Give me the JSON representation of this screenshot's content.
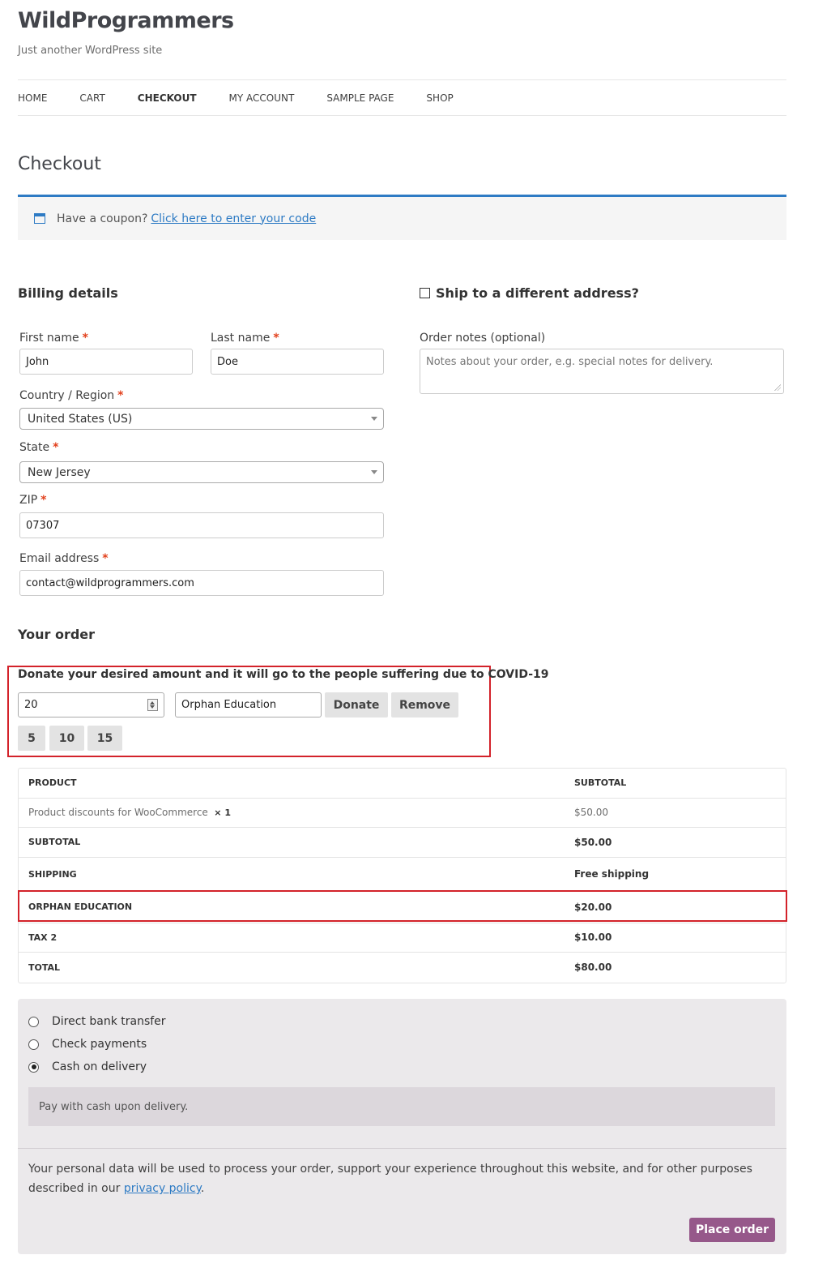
{
  "site": {
    "title": "WildProgrammers",
    "tagline": "Just another WordPress site"
  },
  "nav": {
    "items": [
      "HOME",
      "CART",
      "CHECKOUT",
      "MY ACCOUNT",
      "SAMPLE PAGE",
      "SHOP"
    ],
    "active": "CHECKOUT"
  },
  "page": {
    "title": "Checkout"
  },
  "coupon": {
    "icon": "calendar-icon",
    "prompt": "Have a coupon?",
    "link": "Click here to enter your code"
  },
  "billing": {
    "heading": "Billing details",
    "first_name_label": "First name",
    "first_name_value": "John",
    "last_name_label": "Last name",
    "last_name_value": "Doe",
    "country_label": "Country / Region",
    "country_value": "United States (US)",
    "state_label": "State",
    "state_value": "New Jersey",
    "zip_label": "ZIP",
    "zip_value": "07307",
    "email_label": "Email address",
    "email_value": "contact@wildprogrammers.com",
    "required_mark": "*"
  },
  "shipping": {
    "toggle_label": "Ship to a different address?",
    "notes_label": "Order notes (optional)",
    "notes_placeholder": "Notes about your order, e.g. special notes for delivery."
  },
  "order": {
    "heading": "Your order",
    "donate": {
      "title": "Donate your desired amount and it will go to the people suffering due to COVID-19",
      "amount": "20",
      "cause": "Orphan Education",
      "donate_button": "Donate",
      "remove_button": "Remove",
      "presets": [
        "5",
        "10",
        "15"
      ]
    },
    "table": {
      "headers": [
        "PRODUCT",
        "SUBTOTAL"
      ],
      "item_name": "Product discounts for WooCommerce",
      "item_qty": "× 1",
      "item_price": "$50.00",
      "rows": [
        {
          "label": "SUBTOTAL",
          "value": "$50.00"
        },
        {
          "label": "SHIPPING",
          "value": "Free shipping"
        },
        {
          "label": "ORPHAN EDUCATION",
          "value": "$20.00"
        },
        {
          "label": "TAX 2",
          "value": "$10.00"
        },
        {
          "label": "TOTAL",
          "value": "$80.00"
        }
      ]
    }
  },
  "payment": {
    "options": [
      "Direct bank transfer",
      "Check payments",
      "Cash on delivery"
    ],
    "selected": "Cash on delivery",
    "description": "Pay with cash upon delivery.",
    "privacy_text": "Your personal data will be used to process your order, support your experience throughout this website, and for other purposes described in our",
    "privacy_link": "privacy policy",
    "privacy_end": ".",
    "place_order": "Place order"
  },
  "colors": {
    "accent_blue": "#2e7bc4",
    "required_red": "#e2401c",
    "highlight_red": "#d3222a",
    "place_order_purple": "#96588a"
  }
}
